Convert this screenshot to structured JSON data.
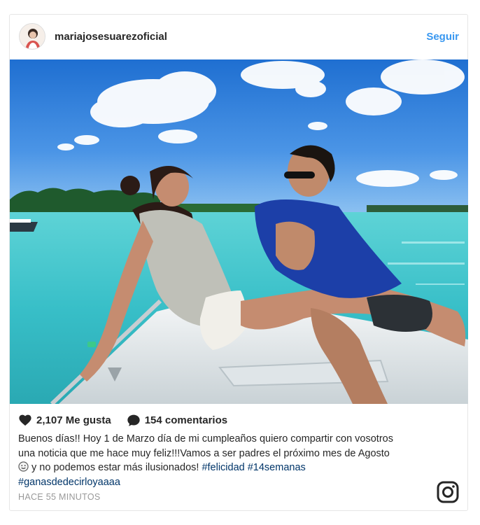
{
  "post": {
    "username": "mariajosesuarezoficial",
    "follow_label": "Seguir",
    "likes_label": "2,107 Me gusta",
    "comments_label": "154 comentarios",
    "caption_line1": "Buenos días!! Hoy 1 de Marzo día de mi cumpleaños quiero compartir con vosotros",
    "caption_line2": "una noticia que me hace muy feliz!!!Vamos a ser padres el próximo mes de Agosto",
    "caption_line3_text": " y no podemos estar más ilusionados! ",
    "hashtag1": "#felicidad",
    "hashtag2": "#14semanas",
    "hashtag3": "#ganasdedecirloyaaaa",
    "timestamp": "HACE 55 MINUTOS"
  },
  "icons": {
    "heart": "heart-icon",
    "comment": "comment-icon",
    "emoji": "smiley-emoji-icon",
    "brand": "instagram-logo-icon"
  },
  "colors": {
    "accent": "#3897f0",
    "hashtag": "#003569",
    "muted": "#999999",
    "text": "#262626"
  }
}
